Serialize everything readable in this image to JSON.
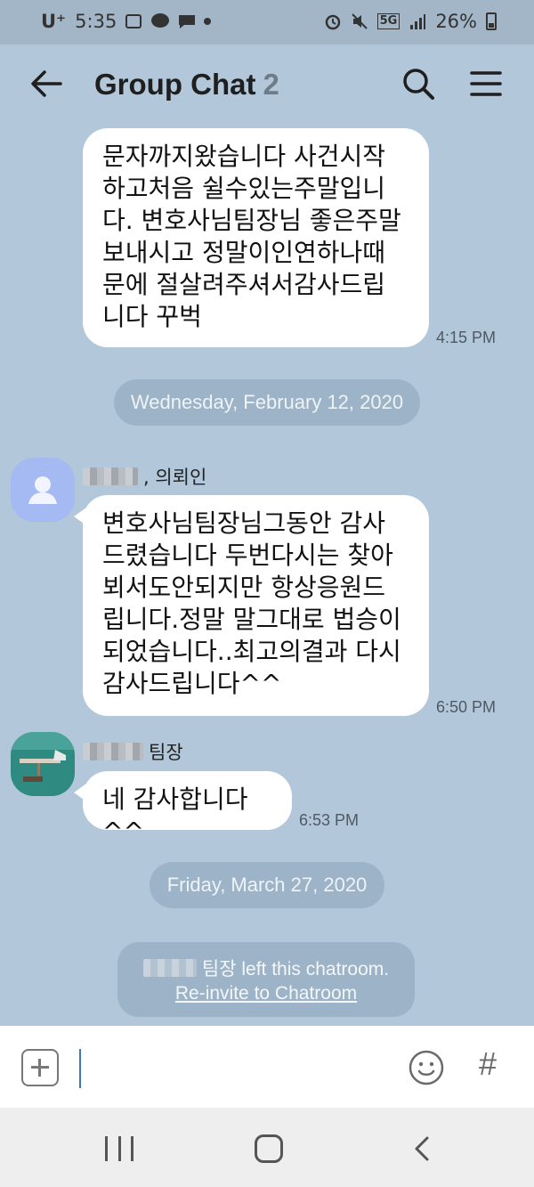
{
  "status_bar": {
    "carrier": "U⁺",
    "time": "5:35",
    "network": "5G",
    "battery": "26%"
  },
  "header": {
    "title": "Group Chat",
    "member_count": "2"
  },
  "messages": [
    {
      "text": "문자까지왔습니다 사건시작\n하고처음 쉴수있는주말입니\n다. 변호사님팀장님 좋은주말\n보내시고 정말이인연하나때\n문에 절살려주셔서감사드립\n니다 꾸벅",
      "time": "4:15 PM"
    },
    {
      "sender": ", 의뢰인",
      "text": "변호사님팀장님그동안 감사\n드렸습니다  두번다시는 찾아\n뵈서도안되지만 항상응원드\n립니다.정말 말그대로 법승이\n되었습니다..최고의결과 다시\n감사드립니다^^",
      "time": "6:50 PM"
    },
    {
      "sender": "팀장",
      "text": "네 감사합니다^^",
      "time": "6:53 PM"
    }
  ],
  "dates": [
    "Wednesday, February 12, 2020",
    "Friday, March 27, 2020"
  ],
  "notice": {
    "text": "팀장 left this chatroom.",
    "link": "Re-invite to Chatroom"
  },
  "input": {
    "hash": "#"
  }
}
